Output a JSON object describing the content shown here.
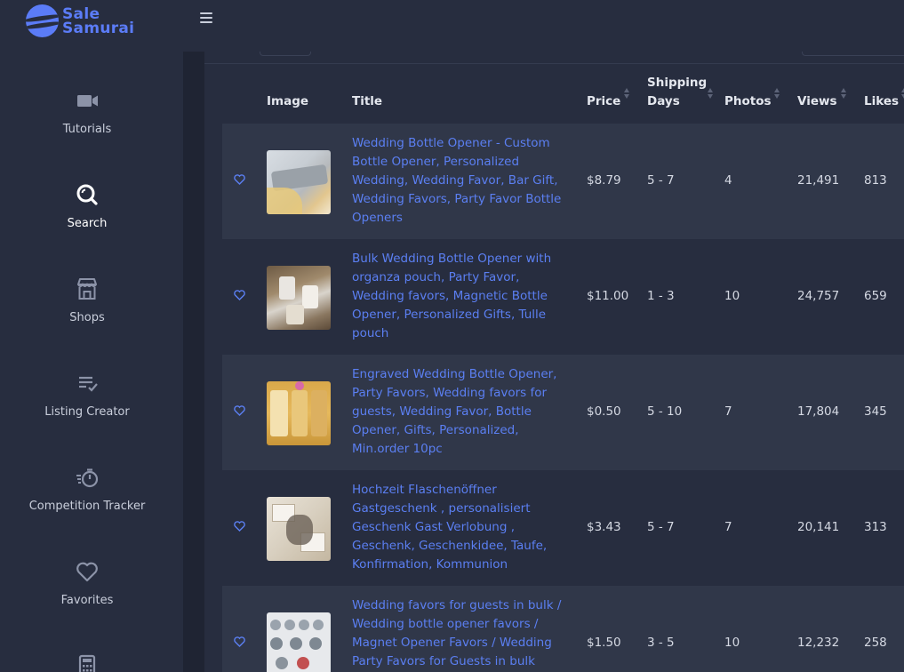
{
  "brand": {
    "line1": "Sale",
    "line2": "Samurai"
  },
  "sidebar": {
    "items": [
      {
        "label": "Tutorials",
        "icon": "video-camera-icon"
      },
      {
        "label": "Search",
        "icon": "search-icon"
      },
      {
        "label": "Shops",
        "icon": "store-icon"
      },
      {
        "label": "Listing Creator",
        "icon": "list-check-icon"
      },
      {
        "label": "Competition Tracker",
        "icon": "stopwatch-icon"
      },
      {
        "label": "Favorites",
        "icon": "heart-icon"
      },
      {
        "label": "",
        "icon": "calculator-icon"
      }
    ]
  },
  "table": {
    "headers": {
      "image": "Image",
      "title": "Title",
      "price": "Price",
      "shipping_line1": "Shipping",
      "shipping_line2": "Days",
      "photos": "Photos",
      "views": "Views",
      "likes": "Likes"
    },
    "rows": [
      {
        "title": "Wedding Bottle Opener - Custom Bottle Opener, Personalized Wedding, Wedding Favor, Bar Gift, Wedding Favors, Party Favor Bottle Openers",
        "price": "$8.79",
        "shipping": "5 - 7",
        "photos": "4",
        "views": "21,491",
        "likes": "813"
      },
      {
        "title": "Bulk Wedding Bottle Opener with organza pouch, Party Favor, Wedding favors, Magnetic Bottle Opener, Personalized Gifts, Tulle pouch",
        "price": "$11.00",
        "shipping": "1 - 3",
        "photos": "10",
        "views": "24,757",
        "likes": "659"
      },
      {
        "title": "Engraved Wedding Bottle Opener, Party Favors, Wedding favors for guests, Wedding Favor, Bottle Opener, Gifts, Personalized, Min.order 10pc",
        "price": "$0.50",
        "shipping": "5 - 10",
        "photos": "7",
        "views": "17,804",
        "likes": "345"
      },
      {
        "title": "Hochzeit Flaschenöffner Gastgeschenk , personalisiert Geschenk Gast Verlobung , Geschenk, Geschenkidee, Taufe, Konfirmation, Kommunion",
        "price": "$3.43",
        "shipping": "5 - 7",
        "photos": "7",
        "views": "20,141",
        "likes": "313"
      },
      {
        "title": "Wedding favors for guests in bulk / Wedding bottle opener favors / Magnet Opener Favors / Wedding Party Favors for Guests in bulk",
        "price": "$1.50",
        "shipping": "3 - 5",
        "photos": "10",
        "views": "12,232",
        "likes": "258"
      }
    ]
  },
  "colors": {
    "background": "#272d3f",
    "row_alt": "#303749",
    "accent": "#5b7cf7",
    "link": "#5b7ff2"
  }
}
